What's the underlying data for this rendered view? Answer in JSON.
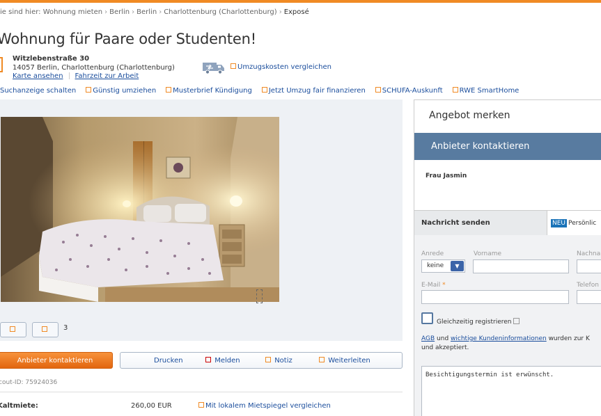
{
  "breadcrumb": {
    "prefix": "ie sind hier:",
    "items": [
      "Wohnung mieten",
      "Berlin",
      "Berlin",
      "Charlottenburg (Charlottenburg)"
    ],
    "current": "Exposé"
  },
  "listing": {
    "title": "Wohnung für Paare oder Studenten!",
    "street": "Witzlebenstraße 30",
    "city": "14057 Berlin, Charlottenburg (Charlottenburg)",
    "map_link": "Karte ansehen",
    "commute_link": "Fahrzeit zur Arbeit",
    "moving_cost_link": "Umzugskosten vergleichen"
  },
  "services": [
    "Suchanzeige schalten",
    "Günstig umziehen",
    "Musterbrief Kündigung",
    "Jetzt Umzug fair finanzieren",
    "SCHUFA-Auskunft",
    "RWE SmartHome"
  ],
  "gallery": {
    "image_count": "3"
  },
  "actions": {
    "contact": "Anbieter kontaktieren",
    "print": "Drucken",
    "report": "Melden",
    "note": "Notiz",
    "forward": "Weiterleiten"
  },
  "scout_id": "cout-ID: 75924036",
  "rent": {
    "label": "Kaltmiete:",
    "value": "260,00 EUR",
    "compare_link": "Mit lokalem Mietspiegel vergleichen"
  },
  "sidebar": {
    "save_offer": "Angebot merken",
    "contact_header": "Anbieter kontaktieren",
    "contact_person": "Frau Jasmin",
    "tab_message": "Nachricht senden",
    "tab_new_badge": "NEU",
    "tab_personal": "Persönlic",
    "form": {
      "salutation_label": "Anrede",
      "salutation_value": "keine",
      "firstname_label": "Vorname",
      "lastname_label": "Nachnam",
      "email_label": "E-Mail",
      "email_required": "*",
      "phone_label": "Telefon",
      "register_label": "Gleichzeitig registrieren",
      "agb_link": "AGB",
      "agb_and": "und",
      "agb_info_link": "wichtige Kundeninformationen",
      "agb_rest": "wurden zur K",
      "agb_line2": "und akzeptiert.",
      "message": "Besichtigungstermin ist erwünscht."
    }
  },
  "colors": {
    "accent": "#f08a24",
    "link": "#1a4d9c",
    "panel_header": "#587ba0"
  }
}
